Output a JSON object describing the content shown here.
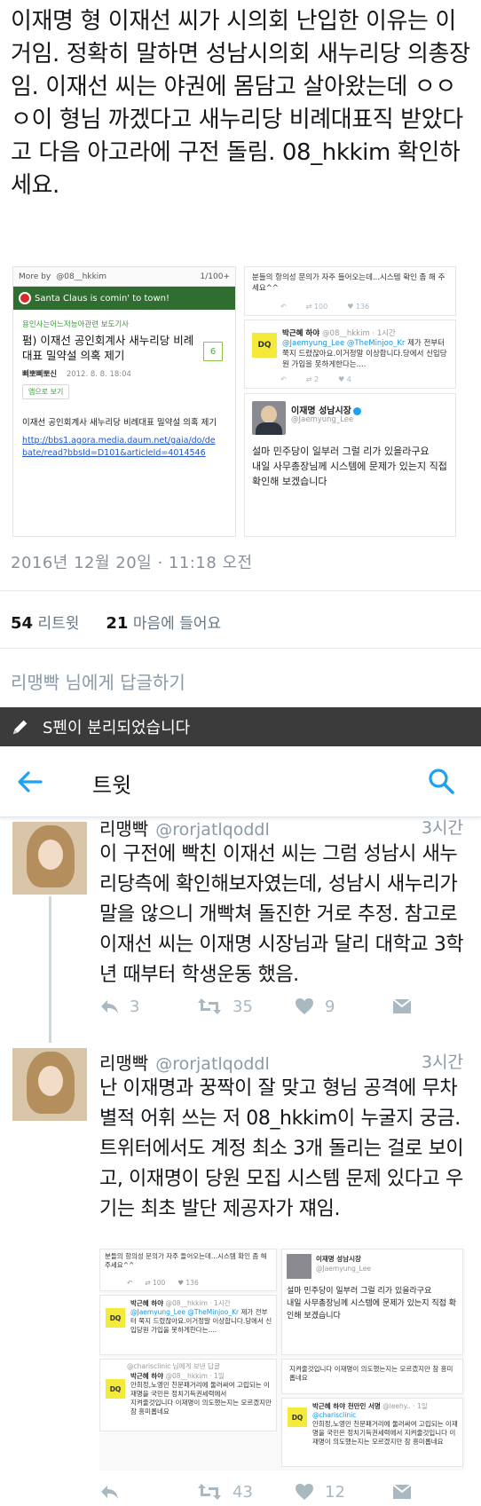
{
  "tweet1": {
    "text": "이재명 형 이재선 씨가 시의회 난입한 이유는 이거임. 정확히 말하면 성남시의회 새누리당 의총장임. 이재선 씨는 야권에 몸담고 살아왔는데 ㅇㅇㅇ이 형님 까겠다고 새누리당 비례대표직 받았다고 다음 아고라에 구전 돌림. 08_hkkim 확인하세요.",
    "date": "2016년 12월 20일 · 11:18 오전",
    "retweet_count": "54",
    "retweet_label": "리트윗",
    "like_count": "21",
    "like_label": "마음에 들어요",
    "reply_prompt": "리맹빡 님에게 답글하기"
  },
  "media": {
    "left": {
      "header_more": "More by",
      "header_handle": "@08__hkkim",
      "header_page": "1/100+",
      "banner": "Santa Claus is comin' to town!",
      "category": "용인사는어느저능아관련 보도기사",
      "title": "펌) 이재선 공인회계사 새누리당 비례대표 밀약설 의혹 제기",
      "badge": "6",
      "meta_author": "삐뽀삐뽀신",
      "meta_date": "2012. 8. 8. 18:04",
      "app_button": "앱으로 보기",
      "body": "이재선 공인회계사 새누리당 비례대표 밀약설 의혹 제기",
      "link": "http://bbs1.agora.media.daum.net/gaia/do/debate/read?bbsId=D101&articleId=4014546"
    },
    "right_top": {
      "text": "분들의 항의성 문의가 자주 들어오는데...시스템 확인 좀 해 주세요^^",
      "rt": "100",
      "like": "136"
    },
    "right_mid": {
      "name": "박근혜 하야",
      "meta": "@08__hkkim · 1시간",
      "mentions": "@Jaemyung_Lee @TheMinjoo_Kr",
      "body": " 제가 전부터 쭉지 드렸잖아요.이거정말 이상합니다.당에서 신입당원 가입을 못하게한다는....",
      "rt": "2",
      "like": "4",
      "avatar_text": "DQ"
    },
    "right_bot": {
      "name": "이재명 성남시장",
      "handle": "@Jaemyung_Lee",
      "body": "설마 민주당이 일부러 그럴 리가 있을라구요\n내일 사무총장님께 시스템에 문제가 있는지 직접 확인해 보겠습니다"
    }
  },
  "statusbar": {
    "text": "S펜이 분리되었습니다"
  },
  "appbar": {
    "title": "트윗"
  },
  "replies": [
    {
      "name": "리맹빡",
      "handle": "@rorjatlqoddl",
      "time": "3시간",
      "text": "이 구전에 빡친 이재선 씨는 그럼 성남시 새누리당측에 확인해보자였는데, 성남시 새누리가 말을 않으니 개빡쳐 돌진한 거로 추정. 참고로 이재선 씨는 이재명 시장님과 달리 대학교 3학년 때부터 학생운동 했음.",
      "reply_count": "3",
      "rt_count": "35",
      "like_count": "9"
    },
    {
      "name": "리맹빡",
      "handle": "@rorjatlqoddl",
      "time": "3시간",
      "text": "난 이재명과 꿍짝이 잘 맞고 형님 공격에 무차별적 어휘 쓰는 저 08_hkkim이 누굴지 궁금. 트위터에서도 계정 최소 3개 돌리는 걸로 보이고, 이재명이 당원 모집 시스템 문제 있다고 우기는 최초 발단 제공자가 쟤임.",
      "reply_count": "",
      "rt_count": "43",
      "like_count": "12"
    }
  ],
  "embedded": {
    "a_text": "분들의 항의성 문의가 자주 들어오는데...시스템 확인 좀 해 주세요^^",
    "a_rt": "100",
    "a_like": "136",
    "b_name": "박근혜 하야",
    "b_meta": "@08__hkkim · 1시간",
    "b_mentions": "@Jaemyung_Lee @TheMinjoo_Kr",
    "b_body": " 제가 전부터 쭉지 드렸잖아요.이거정말 이상합니다.당에서 신입당원 가입을 못하게한다는....",
    "c_name": "이재명 성남시장",
    "c_handle": "@Jaemyung_Lee",
    "c_body": "설마 민주당이 일부러 그럴 리가 있을라구요\n내일 사무총장님께 시스템에 문제가 있는지 직접 확인해 보겠습니다",
    "d_reply_to": "@charisclinic 님에게 보낸 답글",
    "d_name": "박근혜 하야",
    "d_meta": "@08__hkkim · 1일",
    "d_body": "안희정,노영민 친문패거리에 둘러싸여 고립되는 이재명을 국민은 정치기득권세력에서",
    "d_body2": "지켜줄것입니다 이재명이 의도했는지는 모르겠지만 참 흥미롭네요",
    "e_text": "지켜줄것입니다 이재명이 의도했는지는 모르겠지만 참 흥미롭네요",
    "f_name": "박근혜 하야 천만인 서명",
    "f_handle": "@leehy..",
    "f_meta": "· 1일",
    "f_mention": "@charisclinic",
    "f_body": "안희정,노영민 친문패거리에 둘러싸여 고립되는 이재명을 국민은 정치기득권세력에서 지켜줄것입니다 이재명이 의도했는지는 모르겠지만 참 흥미롭네요"
  },
  "colors": {
    "accent": "#1da1f2",
    "muted": "#8a9aa8",
    "status_bar": "#3b3b3b"
  },
  "icons": [
    "pen-icon",
    "back-arrow-icon",
    "search-icon",
    "reply-icon",
    "retweet-icon",
    "heart-icon",
    "dm-icon"
  ]
}
